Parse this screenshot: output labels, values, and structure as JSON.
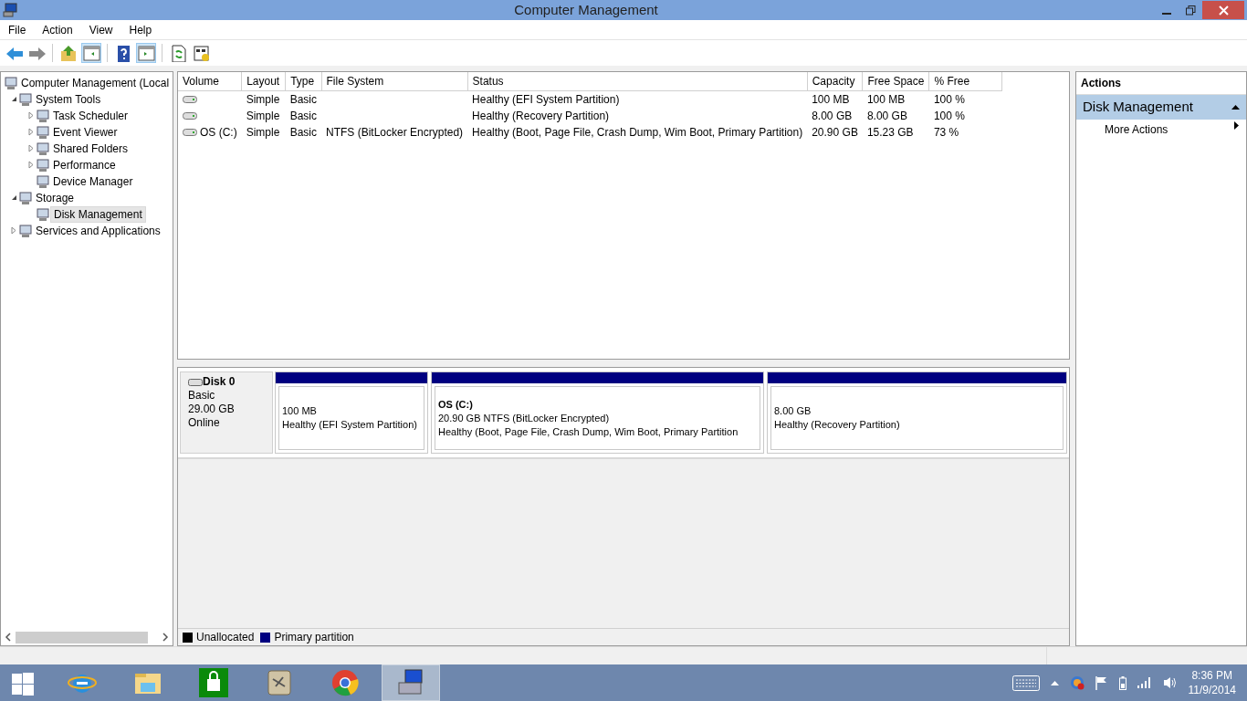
{
  "window": {
    "title": "Computer Management"
  },
  "menu": [
    "File",
    "Action",
    "View",
    "Help"
  ],
  "toolbar": [
    {
      "kind": "back",
      "selected": false
    },
    {
      "kind": "forward",
      "selected": false
    },
    {
      "kind": "up",
      "selected": false
    },
    {
      "kind": "pane",
      "selected": true
    },
    {
      "kind": "help",
      "selected": false
    },
    {
      "kind": "pane2",
      "selected": true
    },
    {
      "kind": "refresh",
      "selected": false
    },
    {
      "kind": "props",
      "selected": false
    }
  ],
  "tree": [
    {
      "label": "Computer Management (Local",
      "selected": false,
      "children": [
        {
          "label": "System Tools",
          "expanded": true,
          "selected": false,
          "children": [
            {
              "label": "Task Scheduler",
              "expanded": false,
              "selected": false
            },
            {
              "label": "Event Viewer",
              "expanded": false,
              "selected": false
            },
            {
              "label": "Shared Folders",
              "expanded": false,
              "selected": false
            },
            {
              "label": "Performance",
              "expanded": false,
              "selected": false
            },
            {
              "label": "Device Manager",
              "selected": false
            }
          ]
        },
        {
          "label": "Storage",
          "expanded": true,
          "selected": false,
          "children": [
            {
              "label": "Disk Management",
              "selected": true
            }
          ]
        },
        {
          "label": "Services and Applications",
          "expanded": false,
          "selected": false
        }
      ]
    }
  ],
  "table": {
    "columns": [
      "Volume",
      "Layout",
      "Type",
      "File System",
      "Status",
      "Capacity",
      "Free Space",
      "% Free"
    ],
    "rows": [
      {
        "layout": "Simple",
        "type": "Basic",
        "status": "Healthy (EFI System Partition)",
        "capacity": "100 MB",
        "free_space": "100 MB",
        "percent_free": "100 %"
      },
      {
        "layout": "Simple",
        "type": "Basic",
        "status": "Healthy (Recovery Partition)",
        "capacity": "8.00 GB",
        "free_space": "8.00 GB",
        "percent_free": "100 %"
      },
      {
        "volume": "OS (C:)",
        "layout": "Simple",
        "type": "Basic",
        "file_system": "NTFS (BitLocker Encrypted)",
        "status": "Healthy (Boot, Page File, Crash Dump, Wim Boot, Primary Partition)",
        "capacity": "20.90 GB",
        "free_space": "15.23 GB",
        "percent_free": "73 %"
      }
    ]
  },
  "disk": {
    "name": "Disk 0",
    "type": "Basic",
    "size": "29.00 GB",
    "status": "Online",
    "partitions": [
      {
        "size": "100 MB",
        "status": "Healthy (EFI System Partition)",
        "color": "#000080"
      },
      {
        "label": "OS  (C:)",
        "size": "20.90 GB NTFS (BitLocker Encrypted)",
        "status": "Healthy (Boot, Page File, Crash Dump, Wim Boot, Primary Partition",
        "color": "#000080"
      },
      {
        "size": "8.00 GB",
        "status": "Healthy (Recovery Partition)",
        "color": "#000080"
      }
    ]
  },
  "legend": [
    {
      "label": "Unallocated",
      "color": "#000000"
    },
    {
      "label": "Primary partition",
      "color": "#000080"
    }
  ],
  "actions": {
    "title": "Actions",
    "section": {
      "label": "Disk Management",
      "expanded": true
    },
    "items": [
      "More Actions"
    ]
  },
  "taskbar": {
    "apps": [
      {
        "kind": "start",
        "selected": false
      },
      {
        "kind": "browser-e",
        "selected": false
      },
      {
        "kind": "folder",
        "selected": false
      },
      {
        "kind": "store",
        "selected": false
      },
      {
        "kind": "game",
        "selected": false
      },
      {
        "kind": "chrome",
        "selected": false
      },
      {
        "kind": "compmgmt",
        "selected": true
      }
    ],
    "time": "8:36 PM",
    "date": "11/9/2014"
  }
}
